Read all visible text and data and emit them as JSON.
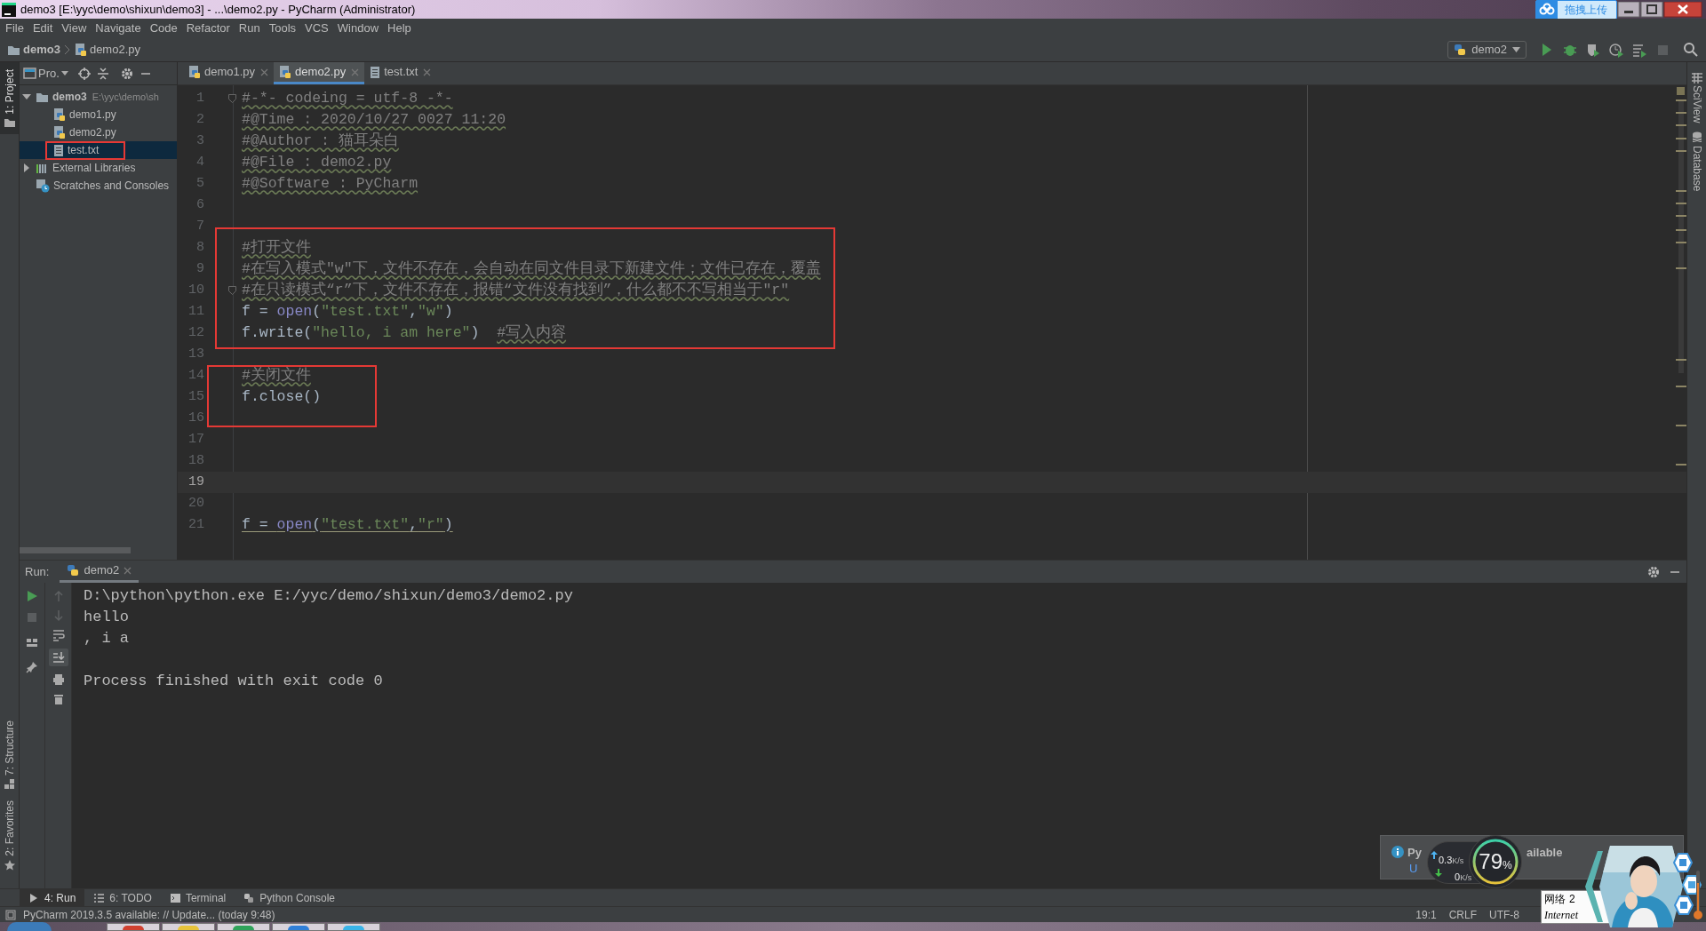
{
  "window": {
    "title": "demo3 [E:\\yyc\\demo\\shixun\\demo3] - ...\\demo2.py - PyCharm (Administrator)",
    "upload_button": "拖拽上传"
  },
  "menu": [
    "File",
    "Edit",
    "View",
    "Navigate",
    "Code",
    "Refactor",
    "Run",
    "Tools",
    "VCS",
    "Window",
    "Help"
  ],
  "breadcrumb": [
    "demo3",
    "demo2.py"
  ],
  "run_config": "demo2",
  "left_top_tools": [
    {
      "label": "1: Project",
      "selected": true
    }
  ],
  "left_bottom_tools": [
    {
      "label": "7: Structure",
      "selected": false
    },
    {
      "label": "2: Favorites",
      "selected": false
    }
  ],
  "right_tools": [
    "SciView",
    "Database"
  ],
  "project_panel": {
    "title": "Pro.",
    "tree": [
      {
        "label": "demo3",
        "path": "E:\\yyc\\demo\\sh",
        "kind": "folder",
        "expanded": true,
        "selected": false,
        "children": [
          {
            "label": "demo1.py",
            "kind": "python",
            "selected": false
          },
          {
            "label": "demo2.py",
            "kind": "python",
            "selected": false
          },
          {
            "label": "test.txt",
            "kind": "text",
            "selected": true
          }
        ]
      },
      {
        "label": "External Libraries",
        "kind": "library",
        "expanded": false,
        "selected": false
      },
      {
        "label": "Scratches and Consoles",
        "kind": "scratch",
        "selected": false
      }
    ]
  },
  "editor": {
    "tabs": [
      {
        "label": "demo1.py",
        "kind": "python",
        "selected": false
      },
      {
        "label": "demo2.py",
        "kind": "python",
        "selected": true
      },
      {
        "label": "test.txt",
        "kind": "text",
        "selected": false
      }
    ],
    "lines": [
      {
        "number": "1",
        "current": false,
        "fold": true,
        "warning": false,
        "tokens": [
          {
            "text": "#-*- codeing = utf-8 -*-",
            "kind": "comment"
          }
        ]
      },
      {
        "number": "2",
        "current": false,
        "fold": false,
        "warning": false,
        "tokens": [
          {
            "text": "#@Time : 2020/10/27 0027 11:20",
            "kind": "comment"
          }
        ]
      },
      {
        "number": "3",
        "current": false,
        "fold": false,
        "warning": false,
        "tokens": [
          {
            "text": "#@Author : 猫耳朵白",
            "kind": "comment"
          }
        ]
      },
      {
        "number": "4",
        "current": false,
        "fold": false,
        "warning": false,
        "tokens": [
          {
            "text": "#@File : demo2.py",
            "kind": "comment"
          }
        ]
      },
      {
        "number": "5",
        "current": false,
        "fold": false,
        "warning": false,
        "tokens": [
          {
            "text": "#@Software : PyCharm",
            "kind": "comment"
          }
        ]
      },
      {
        "number": "6",
        "current": false,
        "fold": false
      },
      {
        "number": "7",
        "current": false,
        "fold": false
      },
      {
        "number": "8",
        "current": false,
        "fold": false,
        "warning": false,
        "tokens": [
          {
            "text": "#打开文件",
            "kind": "comment"
          }
        ]
      },
      {
        "number": "9",
        "current": false,
        "fold": false,
        "warning": false,
        "tokens": [
          {
            "text": "#在写入模式\"w\"下，文件不存在，会自动在同文件目录下新建文件；文件已存在，覆盖",
            "kind": "comment"
          }
        ]
      },
      {
        "number": "10",
        "current": false,
        "fold": true,
        "warning": false,
        "tokens": [
          {
            "text": "#在只读模式“r”下，文件不存在，报错“文件没有找到”，什么都不不写相当于\"r\"",
            "kind": "comment"
          }
        ]
      },
      {
        "number": "11",
        "current": false,
        "fold": false,
        "warning": false,
        "tokens": [
          {
            "text": "f = ",
            "kind": "plain"
          },
          {
            "text": "open",
            "kind": "builtin"
          },
          {
            "text": "(",
            "kind": "plain"
          },
          {
            "text": "\"test.txt\"",
            "kind": "string"
          },
          {
            "text": ",",
            "kind": "plain"
          },
          {
            "text": "\"w\"",
            "kind": "string"
          },
          {
            "text": ")",
            "kind": "plain"
          }
        ]
      },
      {
        "number": "12",
        "current": false,
        "fold": false,
        "warning": false,
        "tokens": [
          {
            "text": "f.write(",
            "kind": "plain"
          },
          {
            "text": "\"hello, i am here\"",
            "kind": "string"
          },
          {
            "text": ")  ",
            "kind": "plain"
          },
          {
            "text": "#写入内容",
            "kind": "comment"
          }
        ]
      },
      {
        "number": "13",
        "current": false,
        "fold": false
      },
      {
        "number": "14",
        "current": false,
        "fold": false,
        "warning": false,
        "tokens": [
          {
            "text": "#关闭文件",
            "kind": "comment"
          }
        ]
      },
      {
        "number": "15",
        "current": false,
        "fold": false,
        "warning": false,
        "tokens": [
          {
            "text": "f.close()",
            "kind": "plain"
          }
        ]
      },
      {
        "number": "16",
        "current": false,
        "fold": false
      },
      {
        "number": "17",
        "current": false,
        "fold": false
      },
      {
        "number": "18",
        "current": false,
        "fold": false
      },
      {
        "number": "19",
        "current": true,
        "fold": false
      },
      {
        "number": "20",
        "current": false,
        "fold": false
      },
      {
        "number": "21",
        "current": false,
        "fold": false,
        "warning": true,
        "tokens": [
          {
            "text": "f = ",
            "kind": "plain"
          },
          {
            "text": "open",
            "kind": "builtin"
          },
          {
            "text": "(",
            "kind": "plain"
          },
          {
            "text": "\"test.txt\"",
            "kind": "string"
          },
          {
            "text": ",",
            "kind": "plain"
          },
          {
            "text": "\"r\"",
            "kind": "string"
          },
          {
            "text": ")",
            "kind": "plain"
          }
        ]
      }
    ]
  },
  "run_panel": {
    "label": "Run:",
    "tab": "demo2",
    "output_blocks": [
      [
        "D:\\python\\python.exe E:/yyc/demo/shixun/demo3/demo2.py",
        "hello",
        ", i a"
      ],
      [
        "Process finished with exit code 0"
      ]
    ]
  },
  "bottom_tabs": [
    {
      "label": "4: Run",
      "kind": "run",
      "selected": true
    },
    {
      "label": "6: TODO",
      "kind": "todo",
      "selected": false
    },
    {
      "label": "Terminal",
      "kind": "terminal",
      "selected": false
    },
    {
      "label": "Python Console",
      "kind": "console",
      "selected": false
    }
  ],
  "status_bar": {
    "message": "PyCharm 2019.3.5 available: // Update... (today 9:48)",
    "items": [
      "19:1",
      "CRLF",
      "UTF-8"
    ]
  },
  "notification": {
    "title_start": "Py",
    "title_end": "ailable",
    "link": "U"
  },
  "network_monitor": {
    "upload": "0.3",
    "upload_unit": "K/s",
    "download": "0",
    "download_unit": "K/s",
    "load": "79",
    "load_unit": "%"
  },
  "tooltip": {
    "title": "网络",
    "count": "2",
    "subtitle": "Internet"
  }
}
